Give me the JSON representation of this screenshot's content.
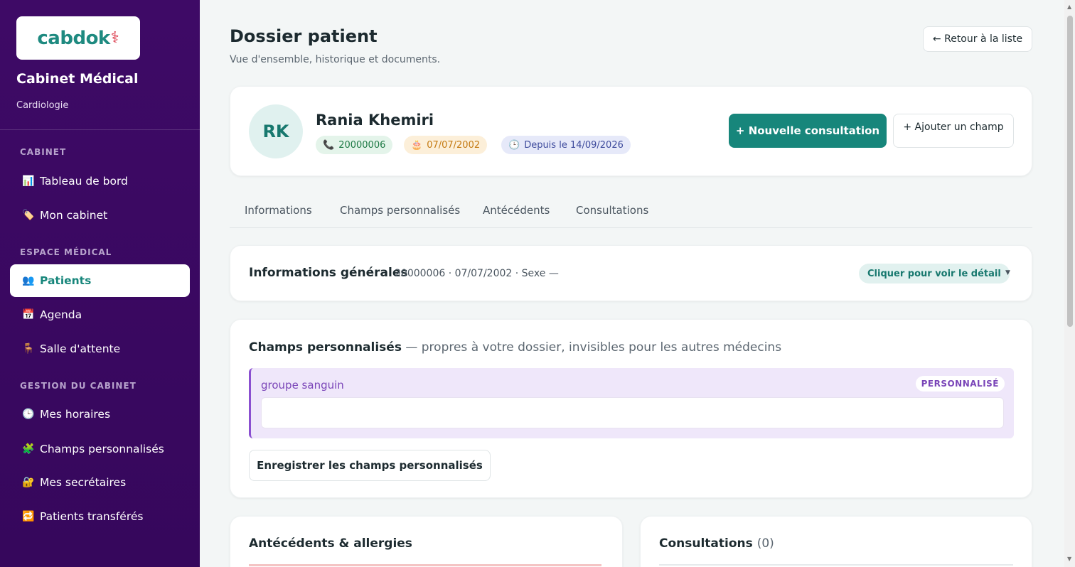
{
  "sidebar": {
    "logo": {
      "text_a": "cab",
      "text_b": "dok",
      "icon": "caduceus-icon"
    },
    "clinic_name": "Cabinet Médical",
    "clinic_specialty": "Cardiologie",
    "sections": [
      {
        "label": "CABINET"
      },
      {
        "label": "ESPACE MÉDICAL"
      },
      {
        "label": "GESTION DU CABINET"
      }
    ],
    "items": [
      {
        "icon": "📊",
        "label": "Tableau de bord"
      },
      {
        "icon": "🏷️",
        "label": "Mon cabinet"
      },
      {
        "icon": "👥",
        "label": "Patients",
        "active": true
      },
      {
        "icon": "📅",
        "label": "Agenda"
      },
      {
        "icon": "🪑",
        "label": "Salle d'attente"
      },
      {
        "icon": "🕒",
        "label": "Mes horaires"
      },
      {
        "icon": "🧩",
        "label": "Champs personnalisés"
      },
      {
        "icon": "🔐",
        "label": "Mes secrétaires"
      },
      {
        "icon": "🔁",
        "label": "Patients transférés"
      }
    ]
  },
  "header": {
    "title": "Dossier patient",
    "subtitle": "Vue d'ensemble, historique et documents.",
    "back_label": "← Retour à la liste"
  },
  "patient": {
    "initials": "RK",
    "name": "Rania Khemiri",
    "phone": "20000006",
    "birthdate": "07/07/2002",
    "since": "Depuis le 14/09/2026",
    "new_consultation_label": "+ Nouvelle consultation",
    "add_field_label": "+ Ajouter un champ"
  },
  "tabs": [
    "Informations",
    "Champs personnalisés",
    "Antécédents",
    "Consultations"
  ],
  "general_info": {
    "title": "Informations générales",
    "summary": "20000006 · 07/07/2002 · Sexe —",
    "detail_label": "Cliquer pour voir le détail",
    "chevron": "▼"
  },
  "custom_fields": {
    "title": "Champs personnalisés",
    "subtitle": " — propres à votre dossier, invisibles pour les autres médecins",
    "fields": [
      {
        "label": "groupe sanguin",
        "badge": "PERSONNALISÉ",
        "value": ""
      }
    ],
    "save_label": "Enregistrer les champs personnalisés"
  },
  "history": {
    "title": "Antécédents & allergies"
  },
  "consultations": {
    "title": "Consultations",
    "count": "(0)"
  },
  "colors": {
    "sidebar_bg": "#3e0a66",
    "accent": "#17867b",
    "custom_field_accent": "#8a4fd0"
  }
}
